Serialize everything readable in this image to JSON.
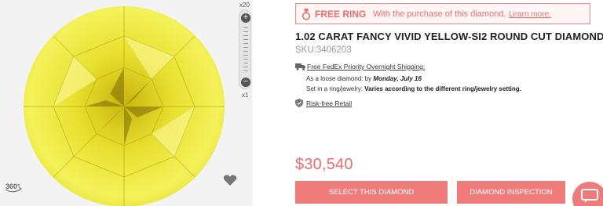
{
  "viewer": {
    "zoom_max_label": "x20",
    "zoom_min_label": "x1",
    "zoom_in_symbol": "+",
    "zoom_out_symbol": "−",
    "badge_360_label": "360°",
    "icons": {
      "zoom_in": "plus-icon",
      "zoom_out": "minus-icon",
      "wishlist": "heart-icon",
      "rotate": "360-view-icon"
    },
    "colors": {
      "diamond_light": "#f2ef3a",
      "diamond_dark": "#8a7a10",
      "background": "#f3f3f3"
    }
  },
  "promo": {
    "strong": "FREE RING",
    "text": "With the purchase of this diamond.",
    "link": "Learn more.",
    "icon": "ring-icon",
    "color": "#e76f6f"
  },
  "product": {
    "title": "1.02 CARAT FANCY VIVID YELLOW-SI2 ROUND CUT DIAMOND",
    "sku": "SKU:3406203",
    "price": "$30,540"
  },
  "shipping": {
    "link": "Free FedEx Priority Overnight Shipping:",
    "loose_prefix": "As a loose diamond: by",
    "loose_date": "Monday, July 16",
    "ring_prefix": "Set in a ring/jewelry:",
    "ring_value": "Varies according to the different ring/jewelry setting.",
    "icon": "truck-icon"
  },
  "risk": {
    "link": "Risk-free Retail",
    "icon": "shield-icon"
  },
  "actions": {
    "select_label": "SELECT THIS DIAMOND",
    "inspect_label": "DIAMOND INSPECTION",
    "accent": "#f07b7b"
  },
  "chat": {
    "icon": "chat-icon"
  }
}
